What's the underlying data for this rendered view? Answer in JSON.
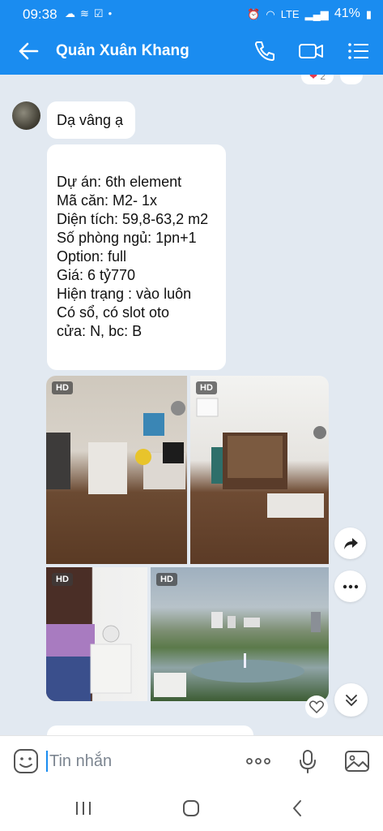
{
  "status_bar": {
    "time": "09:38",
    "battery": "41%"
  },
  "header": {
    "title": "Quản Xuân Khang"
  },
  "messages": {
    "reaction_count": "2",
    "bubble1": "Dạ vâng ạ",
    "bubble2_lines": [
      "Dự án: 6th element",
      "Mã căn: M2- 1x",
      "Diện tích: 59,8-63,2 m2",
      "Số phòng ngủ: 1pn+1",
      "Option: full",
      "Giá: 6 tỷ770",
      "Hiện trạng : vào luôn",
      "Có sổ, có slot oto",
      "cửa: N, bc: B"
    ],
    "photo_badge": "HD"
  },
  "composer": {
    "placeholder": "Tin nhắn"
  },
  "colors": {
    "brand": "#1a8cf0",
    "chat_bg": "#e2e9f1"
  }
}
